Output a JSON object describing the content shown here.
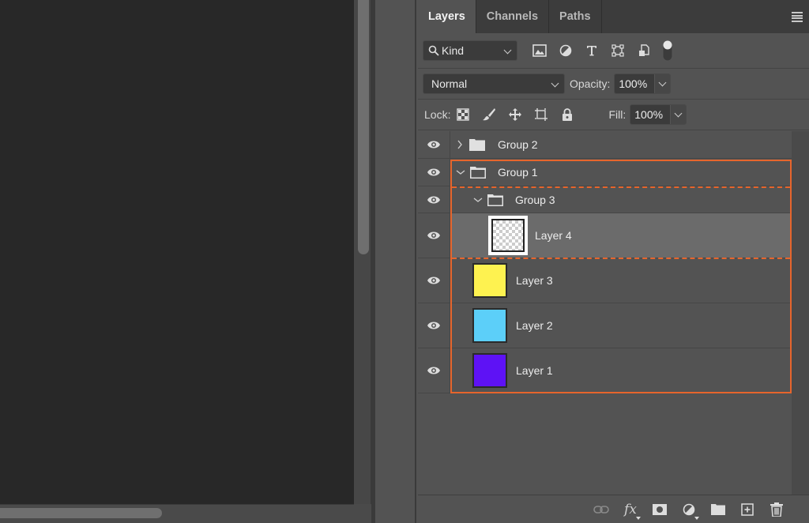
{
  "tabs": [
    {
      "label": "Layers",
      "active": true
    },
    {
      "label": "Channels",
      "active": false
    },
    {
      "label": "Paths",
      "active": false
    }
  ],
  "filter": {
    "kind_label": "Kind",
    "icons": [
      "image-filter-icon",
      "adjustment-filter-icon",
      "type-filter-icon",
      "shape-filter-icon",
      "smart-object-filter-icon",
      "filter-toggle"
    ]
  },
  "blend": {
    "mode": "Normal",
    "opacity_label": "Opacity:",
    "opacity_value": "100%"
  },
  "lock": {
    "label": "Lock:",
    "fill_label": "Fill:",
    "fill_value": "100%"
  },
  "layers": [
    {
      "name": "Group 2",
      "type": "group",
      "expanded": false,
      "visible": true
    },
    {
      "name": "Group 1",
      "type": "group",
      "expanded": true,
      "visible": true
    },
    {
      "name": "Group 3",
      "type": "group",
      "expanded": true,
      "visible": true
    },
    {
      "name": "Layer 4",
      "type": "layer",
      "thumb": "transparent",
      "visible": true,
      "selected": true
    },
    {
      "name": "Layer 3",
      "type": "layer",
      "thumb": "#fef250",
      "visible": true
    },
    {
      "name": "Layer 2",
      "type": "layer",
      "thumb": "#5ccff9",
      "visible": true
    },
    {
      "name": "Layer 1",
      "type": "layer",
      "thumb": "#5e12f5",
      "visible": true
    }
  ],
  "colors": {
    "highlight": "#e6652c",
    "selected_row": "#6b6b6b"
  },
  "footer_icons": [
    "link-layers-icon",
    "fx-icon",
    "add-mask-icon",
    "adjustment-layer-icon",
    "new-group-icon",
    "new-layer-icon",
    "delete-icon"
  ]
}
